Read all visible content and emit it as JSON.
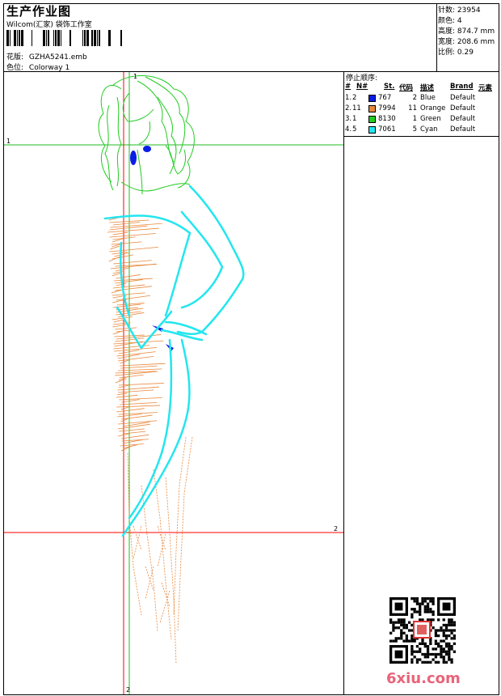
{
  "header": {
    "title": "生产作业图",
    "studio": "Wilcom(汇家) 袋饰工作室",
    "design_label": "花版:",
    "design_value": "GZHA5241.emb",
    "colorway_label": "色位:",
    "colorway_value": "Colorway 1"
  },
  "stats": [
    {
      "label": "针数:",
      "value": "23954"
    },
    {
      "label": "颜色:",
      "value": "4"
    },
    {
      "label": "高度:",
      "value": "874.7 mm"
    },
    {
      "label": "宽度:",
      "value": "208.6 mm"
    },
    {
      "label": "比例:",
      "value": "0.29"
    }
  ],
  "stop_sequence": {
    "title": "停止顺序:",
    "headers": {
      "index": "#",
      "needle": "N#",
      "stitches": "St.",
      "code": "代码",
      "desc": "描述",
      "brand": "Brand",
      "element": "元素"
    },
    "rows": [
      {
        "index": "1.",
        "needle": "2",
        "color": "#0a1ee6",
        "stitches": "767",
        "code": "2",
        "desc": "Blue",
        "brand": "Default"
      },
      {
        "index": "2.",
        "needle": "11",
        "color": "#e8873a",
        "stitches": "7994",
        "code": "11",
        "desc": "Orange",
        "brand": "Default"
      },
      {
        "index": "3.",
        "needle": "1",
        "color": "#22cc22",
        "stitches": "8130",
        "code": "1",
        "desc": "Green",
        "brand": "Default"
      },
      {
        "index": "4.",
        "needle": "5",
        "color": "#22e6ee",
        "stitches": "7061",
        "code": "5",
        "desc": "Cyan",
        "brand": "Default"
      }
    ]
  },
  "canvas": {
    "axis_labels": {
      "top": "1",
      "left": "1",
      "right": "2",
      "bottom": "2"
    },
    "h_axis_color": "#ff0000",
    "v_axis_color": "#00aa00"
  },
  "watermark": "6xiu.com"
}
